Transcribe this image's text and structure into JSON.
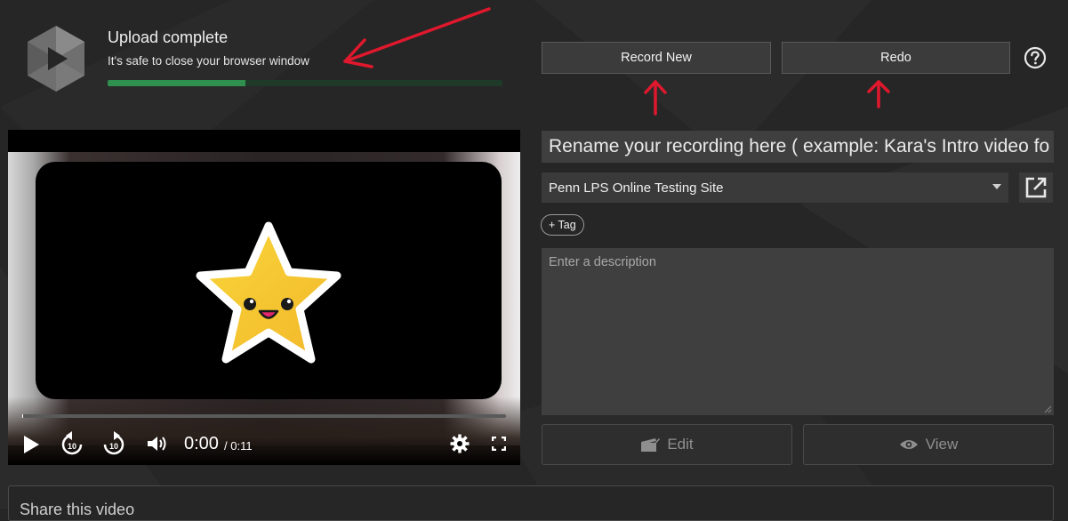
{
  "upload": {
    "title": "Upload complete",
    "subtitle": "It's safe to close your browser window",
    "progress_percent": 35,
    "progress_color": "#2f8f4f"
  },
  "actions": {
    "record_new_label": "Record New",
    "redo_label": "Redo",
    "help_icon": "question-circle-icon"
  },
  "annotations": {
    "arrow_color": "#e0182d"
  },
  "player": {
    "current_time": "0:00",
    "total_time": "/ 0:11",
    "controls": [
      "play-icon",
      "rewind-10-icon",
      "forward-10-icon",
      "volume-icon",
      "settings-gear-icon",
      "fullscreen-icon"
    ]
  },
  "form": {
    "title_value": "Rename your recording here ( example: Kara's Intro video fo",
    "folder_selected": "Penn LPS Online Testing Site",
    "tag_label": "+ Tag",
    "description_placeholder": "Enter a description",
    "edit_label": "Edit",
    "view_label": "View"
  },
  "share": {
    "label": "Share this video"
  },
  "colors": {
    "background": "#262626",
    "star": "#f5c72f"
  }
}
